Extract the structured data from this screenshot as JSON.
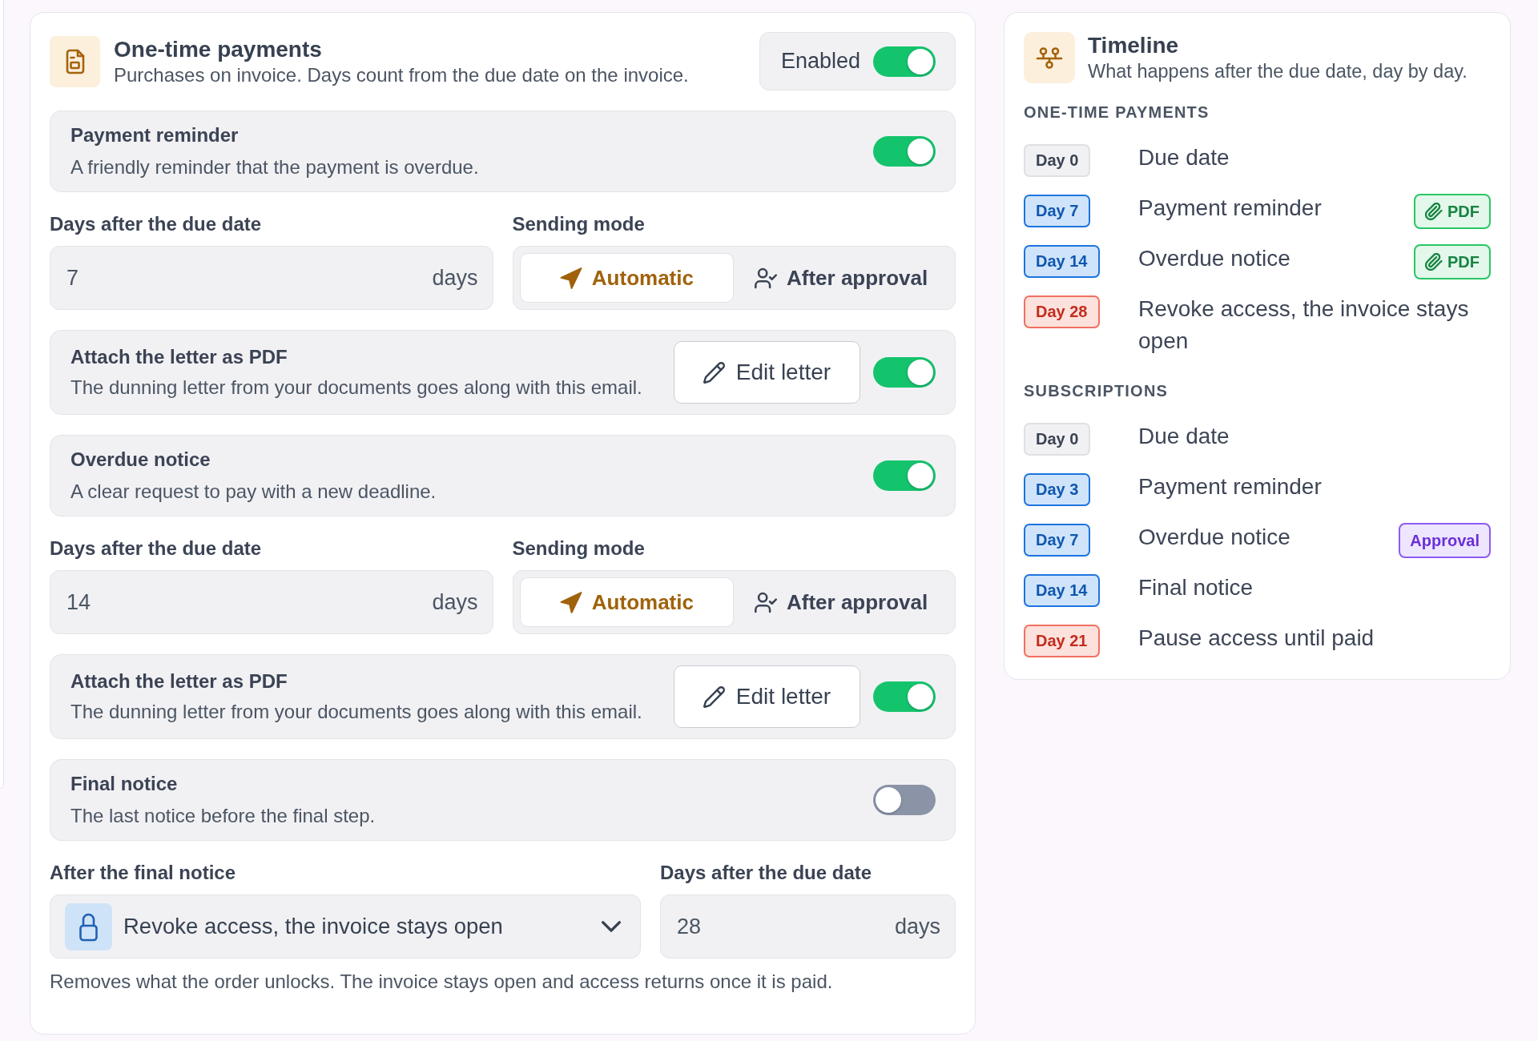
{
  "one_time_payments": {
    "title": "One-time payments",
    "subtitle": "Purchases on invoice. Days count from the due date on the invoice.",
    "enabled": {
      "label": "Enabled",
      "on": true
    },
    "notices": [
      {
        "title": "Payment reminder",
        "description": "A friendly reminder that the payment is overdue.",
        "on": true,
        "days": {
          "label": "Days after the due date",
          "value": "7",
          "unit": "days"
        },
        "sending_mode": {
          "label": "Sending mode",
          "options": [
            {
              "label": "Automatic",
              "selected": true
            },
            {
              "label": "After approval",
              "selected": false
            }
          ]
        },
        "attachment": {
          "title": "Attach the letter as PDF",
          "description": "The dunning letter from your documents goes along with this email.",
          "button": "Edit letter",
          "on": true
        }
      },
      {
        "title": "Overdue notice",
        "description": "A clear request to pay with a new deadline.",
        "on": true,
        "days": {
          "label": "Days after the due date",
          "value": "14",
          "unit": "days"
        },
        "sending_mode": {
          "label": "Sending mode",
          "options": [
            {
              "label": "Automatic",
              "selected": true
            },
            {
              "label": "After approval",
              "selected": false
            }
          ]
        },
        "attachment": {
          "title": "Attach the letter as PDF",
          "description": "The dunning letter from your documents goes along with this email.",
          "button": "Edit letter",
          "on": true
        }
      },
      {
        "title": "Final notice",
        "description": "The last notice before the final step.",
        "on": false
      }
    ],
    "after_final_notice": {
      "action": {
        "label": "After the final notice",
        "value": "Revoke access, the invoice stays open"
      },
      "days": {
        "label": "Days after the due date",
        "value": "28",
        "unit": "days"
      },
      "note": "Removes what the order unlocks. The invoice stays open and access returns once it is paid."
    }
  },
  "timeline": {
    "title": "Timeline",
    "subtitle": "What happens after the due date, day by day.",
    "sections": [
      {
        "heading": "ONE-TIME PAYMENTS",
        "events": [
          {
            "day": "Day 0",
            "kind": "due",
            "label": "Due date"
          },
          {
            "day": "Day 7",
            "kind": "notice",
            "label": "Payment reminder",
            "tag": {
              "kind": "pdf",
              "text": "PDF"
            }
          },
          {
            "day": "Day 14",
            "kind": "notice",
            "label": "Overdue notice",
            "tag": {
              "kind": "pdf",
              "text": "PDF"
            }
          },
          {
            "day": "Day 28",
            "kind": "access",
            "label": "Revoke access, the invoice stays open"
          }
        ]
      },
      {
        "heading": "SUBSCRIPTIONS",
        "events": [
          {
            "day": "Day 0",
            "kind": "due",
            "label": "Due date"
          },
          {
            "day": "Day 3",
            "kind": "notice",
            "label": "Payment reminder"
          },
          {
            "day": "Day 7",
            "kind": "notice",
            "label": "Overdue notice",
            "tag": {
              "kind": "approval",
              "text": "Approval"
            }
          },
          {
            "day": "Day 14",
            "kind": "notice",
            "label": "Final notice"
          },
          {
            "day": "Day 21",
            "kind": "access",
            "label": "Pause access until paid"
          }
        ]
      }
    ]
  }
}
